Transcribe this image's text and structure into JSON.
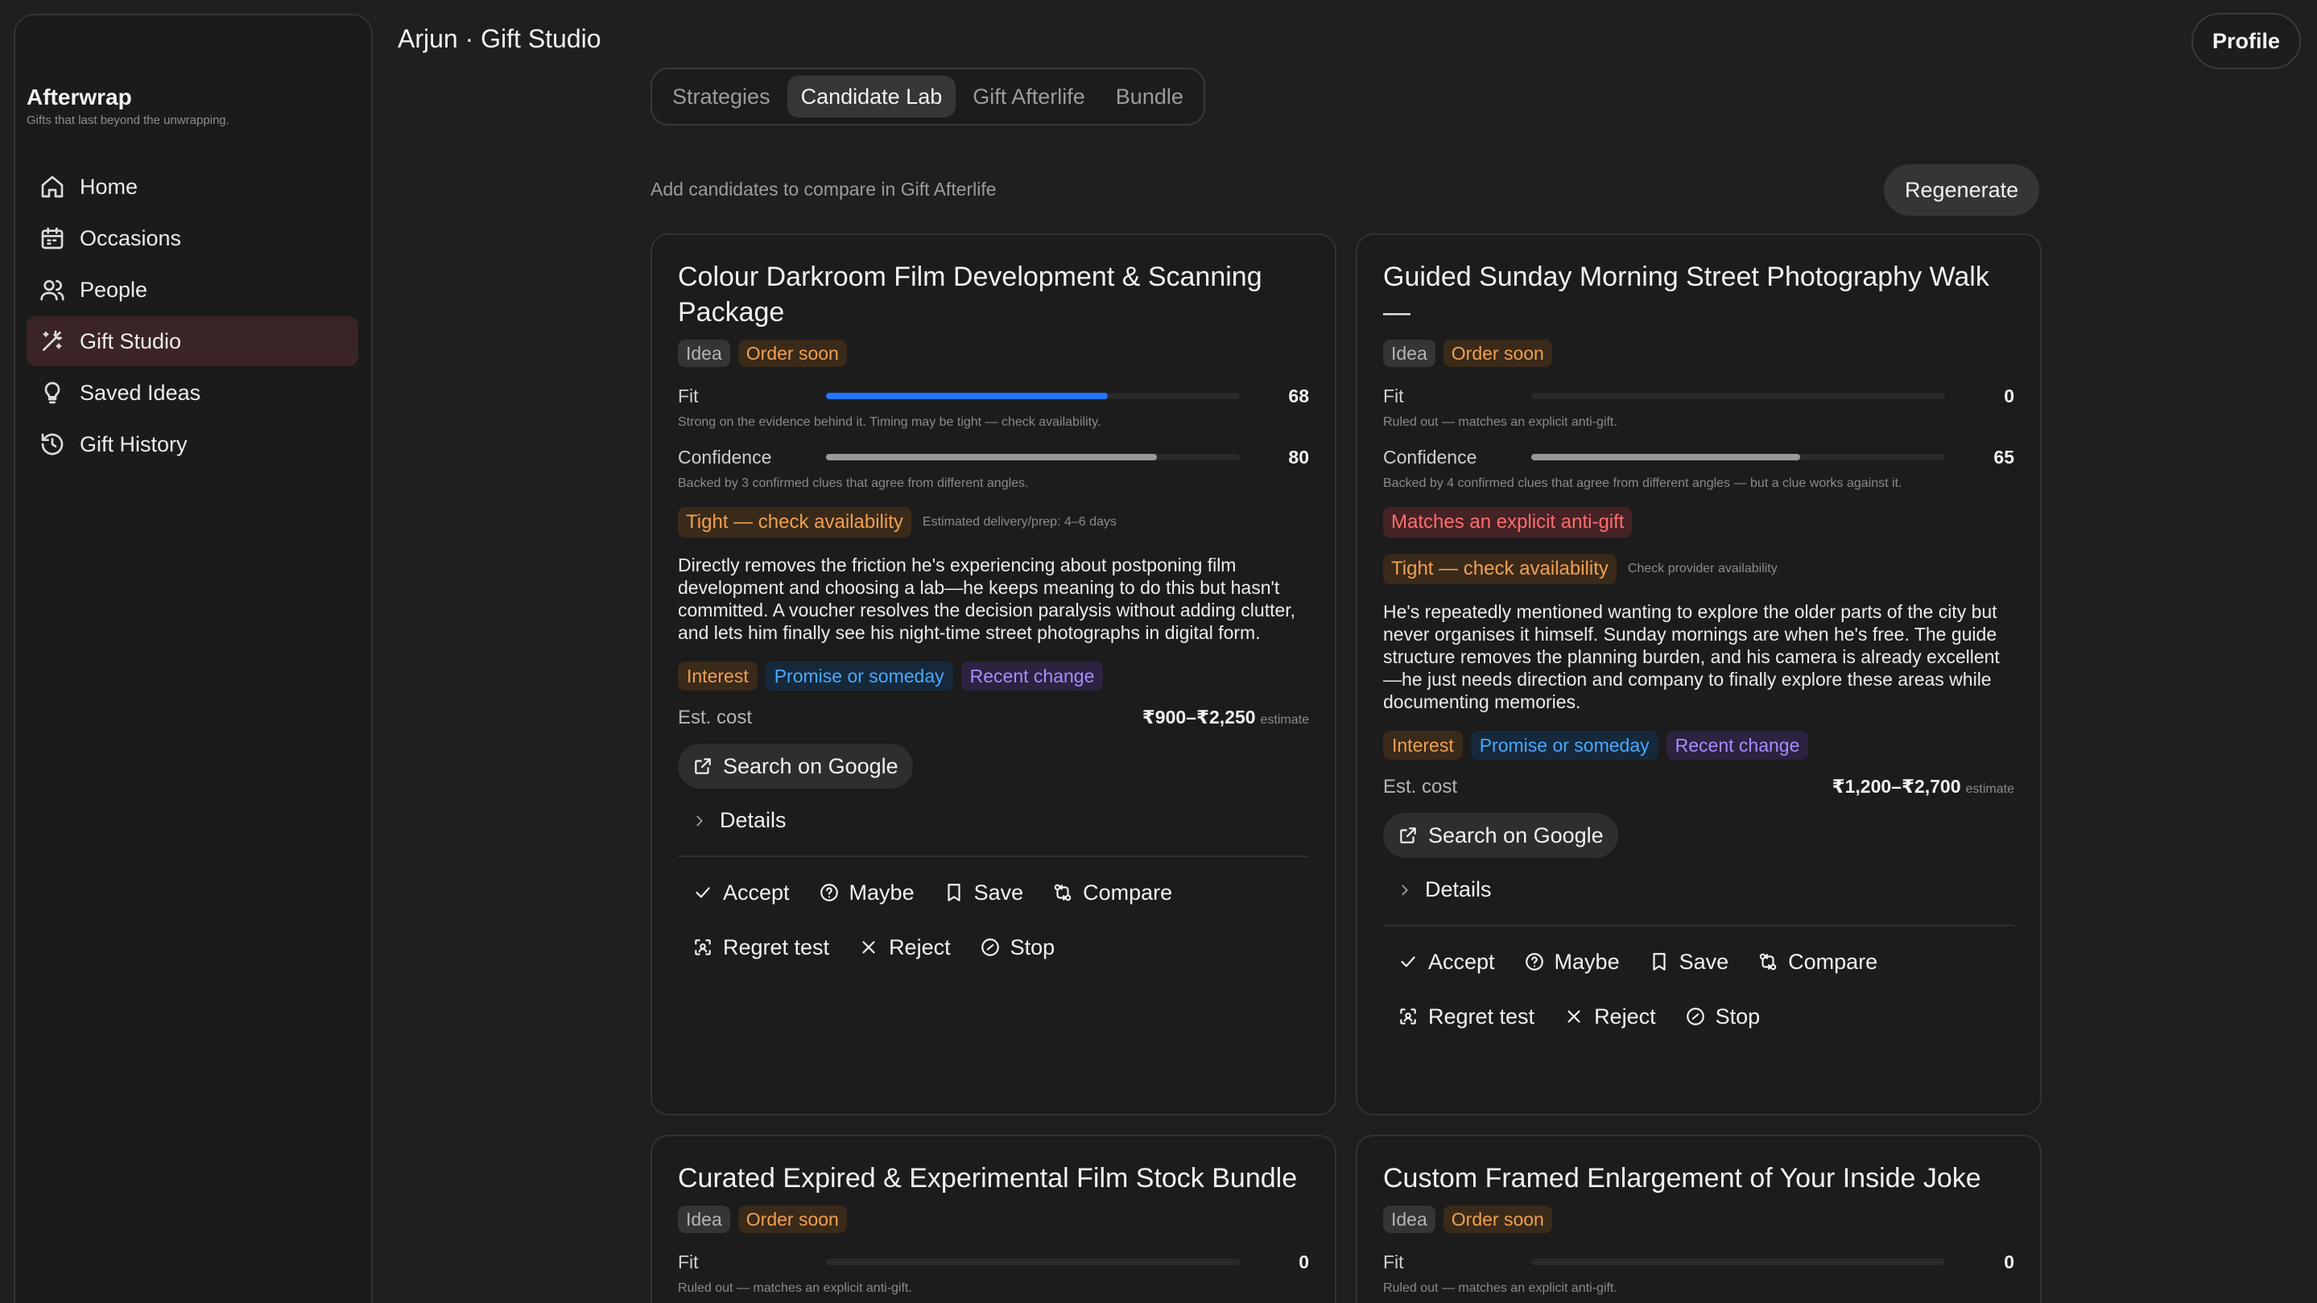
{
  "sidebar": {
    "brand_name": "Afterwrap",
    "brand_tagline": "Gifts that last beyond the unwrapping.",
    "items": [
      {
        "label": "Home",
        "icon": "home-icon"
      },
      {
        "label": "Occasions",
        "icon": "calendar-icon"
      },
      {
        "label": "People",
        "icon": "people-icon"
      },
      {
        "label": "Gift Studio",
        "icon": "magic-wand-icon",
        "active": true
      },
      {
        "label": "Saved Ideas",
        "icon": "lightbulb-icon"
      },
      {
        "label": "Gift History",
        "icon": "history-icon"
      }
    ]
  },
  "header": {
    "title": "Arjun · Gift Studio",
    "profile_label": "Profile"
  },
  "tabs": [
    {
      "label": "Strategies"
    },
    {
      "label": "Candidate Lab",
      "active": true
    },
    {
      "label": "Gift Afterlife"
    },
    {
      "label": "Bundle"
    }
  ],
  "hint": "Add candidates to compare in Gift Afterlife",
  "regenerate_label": "Regenerate",
  "labels": {
    "fit": "Fit",
    "confidence": "Confidence",
    "est_cost": "Est. cost",
    "estimate": "estimate",
    "search_google": "Search on Google",
    "details": "Details",
    "accept": "Accept",
    "maybe": "Maybe",
    "save": "Save",
    "compare": "Compare",
    "regret_test": "Regret test",
    "reject": "Reject",
    "stop": "Stop"
  },
  "cards": [
    {
      "title": "Colour Darkroom Film Development & Scanning Package",
      "badge_type": "Idea",
      "badge_timing": "Order soon",
      "fit": 68,
      "fit_note": "Strong on the evidence behind it. Timing may be tight — check availability.",
      "confidence": 80,
      "confidence_note": "Backed by 3 confirmed clues that agree from different angles.",
      "timing_label": "Tight — check availability",
      "timing_note": "Estimated delivery/prep: 4–6 days",
      "description": "Directly removes the friction he's experiencing about postponing film development and choosing a lab—he keeps meaning to do this but hasn't committed. A voucher resolves the decision paralysis without adding clutter, and lets him finally see his night-time street photographs in digital form.",
      "tags": [
        "Interest",
        "Promise or someday",
        "Recent change"
      ],
      "cost": "₹900–₹2,250"
    },
    {
      "title": "Guided Sunday Morning Street Photography Walk —",
      "badge_type": "Idea",
      "badge_timing": "Order soon",
      "fit": 0,
      "fit_note": "Ruled out — matches an explicit anti-gift.",
      "confidence": 65,
      "confidence_note": "Backed by 4 confirmed clues that agree from different angles — but a clue works against it.",
      "anti_label": "Matches an explicit anti-gift",
      "timing_label": "Tight — check availability",
      "timing_note": "Check provider availability",
      "description": "He's repeatedly mentioned wanting to explore the older parts of the city but never organises it himself. Sunday mornings are when he's free. The guide structure removes the planning burden, and his camera is already excellent—he just needs direction and company to finally explore these areas while documenting memories.",
      "tags": [
        "Interest",
        "Promise or someday",
        "Recent change"
      ],
      "cost": "₹1,200–₹2,700"
    },
    {
      "title": "Curated Expired & Experimental Film Stock Bundle",
      "badge_type": "Idea",
      "badge_timing": "Order soon",
      "fit": 0,
      "fit_note": "Ruled out — matches an explicit anti-gift."
    },
    {
      "title": "Custom Framed Enlargement of Your Inside Joke",
      "badge_type": "Idea",
      "badge_timing": "Order soon",
      "fit": 0,
      "fit_note": "Ruled out — matches an explicit anti-gift."
    }
  ]
}
